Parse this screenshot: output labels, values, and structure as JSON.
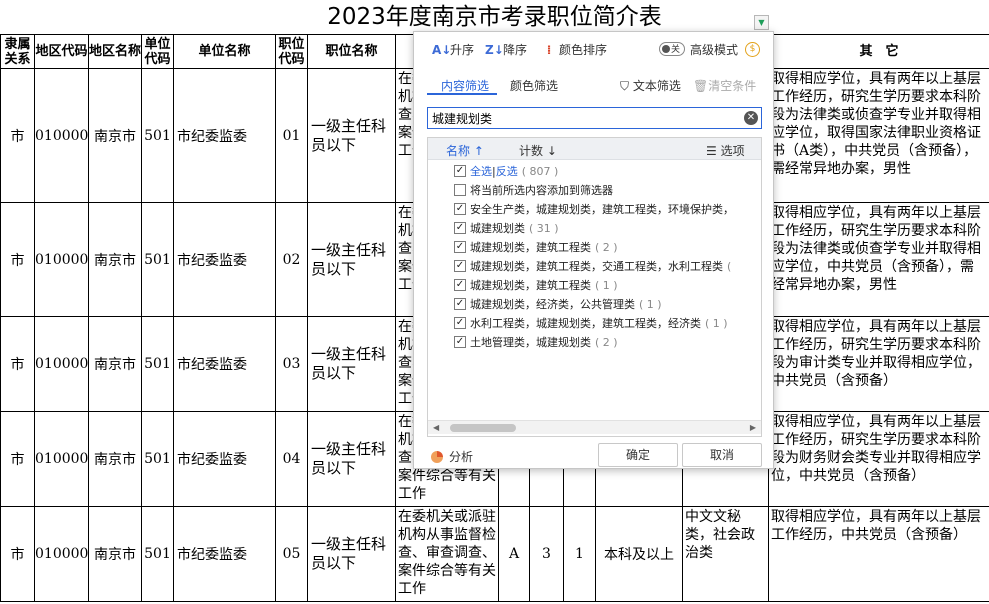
{
  "sheet": {
    "title": "2023年度南京市考录职位简介表",
    "headers": [
      "隶属关系",
      "地区代码",
      "地区名称",
      "单位代码",
      "单位名称",
      "职位代码",
      "职位名称",
      "",
      "",
      "",
      "",
      "",
      "",
      "其　它"
    ],
    "rows": [
      {
        "rel": "市",
        "area_code": "010000",
        "area_name": "南京市",
        "unit_code": "501",
        "unit_name": "市纪委监委",
        "pos_code": "01",
        "pos_name": "一级主任科员以下",
        "duty": "在委机关或派驻机构从事监督检查、审查调查、案件综合等有关工作",
        "c1": "",
        "c2": "",
        "c3": "",
        "edu": "",
        "major": "",
        "other": "取得相应学位，具有两年以上基层工作经历，研究生学历要求本科阶段为法律类或侦查学专业并取得相应学位，取得国家法律职业资格证书（A类），中共党员（含预备），需经常异地办案，男性"
      },
      {
        "rel": "市",
        "area_code": "010000",
        "area_name": "南京市",
        "unit_code": "501",
        "unit_name": "市纪委监委",
        "pos_code": "02",
        "pos_name": "一级主任科员以下",
        "duty": "在委机关或派驻机构从事监督检查、审查调查、案件综合等有关工作",
        "c1": "",
        "c2": "",
        "c3": "",
        "edu": "",
        "major": "",
        "other": "取得相应学位，具有两年以上基层工作经历，研究生学历要求本科阶段为法律类或侦查学专业并取得相应学位，中共党员（含预备），需经常异地办案，男性"
      },
      {
        "rel": "市",
        "area_code": "010000",
        "area_name": "南京市",
        "unit_code": "501",
        "unit_name": "市纪委监委",
        "pos_code": "03",
        "pos_name": "一级主任科员以下",
        "duty": "在委机关或派驻机构从事监督检查、审查调查、案件综合等有关工作",
        "c1": "",
        "c2": "",
        "c3": "",
        "edu": "",
        "major": "",
        "other": "取得相应学位，具有两年以上基层工作经历，研究生学历要求本科阶段为审计类专业并取得相应学位，中共党员（含预备）"
      },
      {
        "rel": "市",
        "area_code": "010000",
        "area_name": "南京市",
        "unit_code": "501",
        "unit_name": "市纪委监委",
        "pos_code": "04",
        "pos_name": "一级主任科员以下",
        "duty": "在委机关或派驻机构从事监督检查、审查调查、案件综合等有关工作",
        "c1": "",
        "c2": "",
        "c3": "",
        "edu": "",
        "major": "",
        "other": "取得相应学位，具有两年以上基层工作经历，研究生学历要求本科阶段为财务财会类专业并取得相应学位，中共党员（含预备）"
      },
      {
        "rel": "市",
        "area_code": "010000",
        "area_name": "南京市",
        "unit_code": "501",
        "unit_name": "市纪委监委",
        "pos_code": "05",
        "pos_name": "一级主任科员以下",
        "duty": "在委机关或派驻机构从事监督检查、审查调查、案件综合等有关工作",
        "c1": "A",
        "c2": "3",
        "c3": "1",
        "edu": "本科及以上",
        "major": "中文文秘类，社会政治类",
        "other": "取得相应学位，具有两年以上基层工作经历，中共党员（含预备）"
      }
    ]
  },
  "filter": {
    "toolbar": {
      "sort_asc": "升序",
      "sort_desc": "降序",
      "color_sort": "颜色排序",
      "toggle_state": "关",
      "advanced_mode": "高级模式"
    },
    "tabs": {
      "content": "内容筛选",
      "color": "颜色筛选"
    },
    "text_filter": "文本筛选",
    "clear_conditions": "清空条件",
    "search": {
      "value": "城建规划类"
    },
    "list_header": {
      "name": "名称",
      "count": "计数",
      "options": "选项"
    },
    "select_all": {
      "all": "全选",
      "sep": "|",
      "invert": "反选",
      "count": "( 807 )"
    },
    "add_to_filter": "将当前所选内容添加到筛选器",
    "items": [
      {
        "label": "安全生产类，城建规划类，建筑工程类，环境保护类，",
        "count": "",
        "checked": true
      },
      {
        "label": "城建规划类",
        "count": "( 31 )",
        "checked": true
      },
      {
        "label": "城建规划类，建筑工程类",
        "count": "( 2 )",
        "checked": true
      },
      {
        "label": "城建规划类，建筑工程类，交通工程类，水利工程类",
        "count": "(",
        "checked": true
      },
      {
        "label": "城建规划类，建筑工程类",
        "count": "( 1 )",
        "checked": true
      },
      {
        "label": "城建规划类，经济类，公共管理类",
        "count": "( 1 )",
        "checked": true
      },
      {
        "label": "水利工程类，城建规划类，建筑工程类，经济类",
        "count": "( 1 )",
        "checked": true
      },
      {
        "label": "土地管理类，城建规划类",
        "count": "( 2 )",
        "checked": true
      }
    ],
    "analyze": "分析",
    "ok": "确定",
    "cancel": "取消"
  }
}
